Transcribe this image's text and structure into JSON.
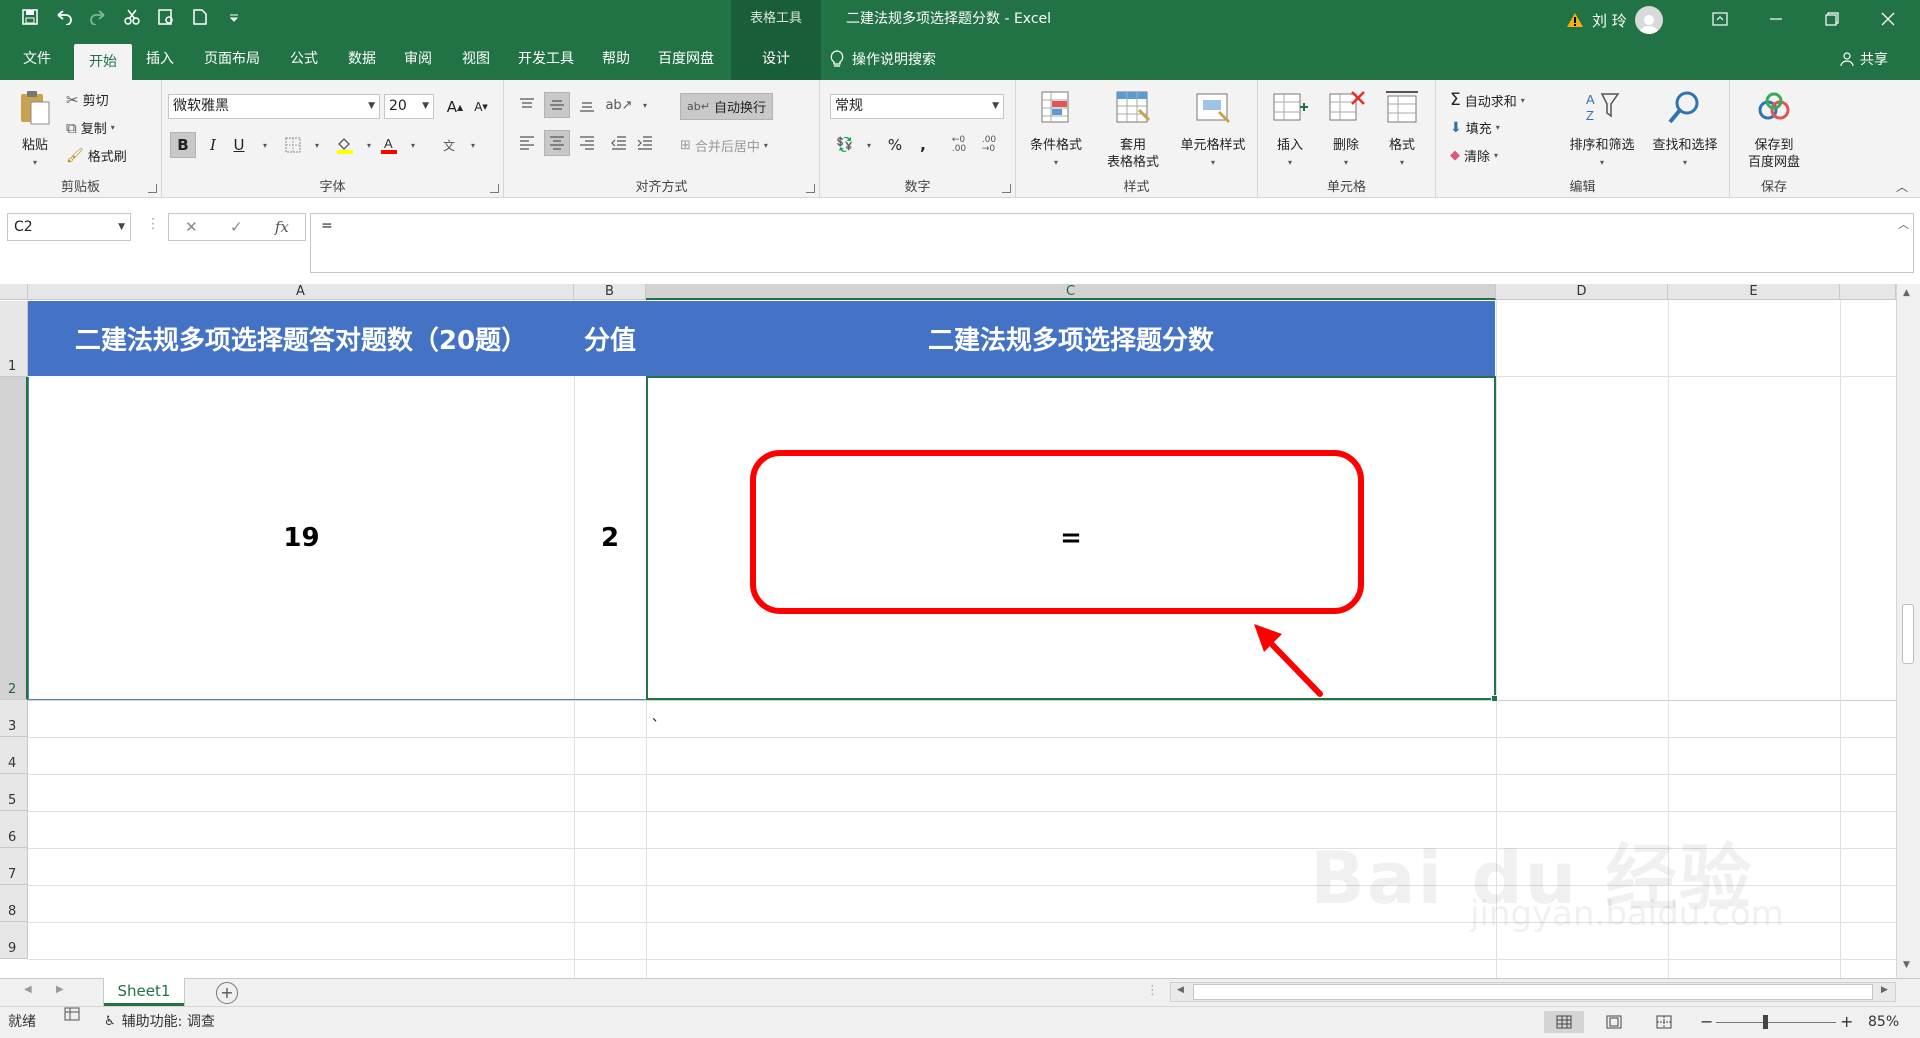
{
  "window": {
    "context_tab": "表格工具",
    "title": "二建法规多项选择题分数 - Excel",
    "user_name": "刘 玲"
  },
  "tabs": {
    "file": "文件",
    "home": "开始",
    "insert": "插入",
    "page_layout": "页面布局",
    "formulas": "公式",
    "data": "数据",
    "review": "审阅",
    "view": "视图",
    "developer": "开发工具",
    "help": "帮助",
    "baidu_disk": "百度网盘",
    "design": "设计",
    "search": "操作说明搜索",
    "share": "共享"
  },
  "ribbon": {
    "clipboard": {
      "paste": "粘贴",
      "cut": "剪切",
      "copy": "复制",
      "format_painter": "格式刷",
      "label": "剪贴板"
    },
    "font": {
      "name": "微软雅黑",
      "size": "20",
      "label": "字体",
      "bold": "B",
      "italic": "I",
      "underline": "U"
    },
    "alignment": {
      "wrap_text": "自动换行",
      "merge_center": "合并后居中",
      "label": "对齐方式"
    },
    "number": {
      "format": "常规",
      "percent": "%",
      "comma": ",",
      "label": "数字"
    },
    "styles": {
      "conditional": "条件格式",
      "table_format_1": "套用",
      "table_format_2": "表格格式",
      "cell_styles": "单元格样式",
      "label": "样式"
    },
    "cells": {
      "insert": "插入",
      "delete": "删除",
      "format": "格式",
      "label": "单元格"
    },
    "editing": {
      "autosum": "自动求和",
      "fill": "填充",
      "clear": "清除",
      "sort_filter": "排序和筛选",
      "find_select": "查找和选择",
      "label": "编辑"
    },
    "save": {
      "save_1": "保存到",
      "save_2": "百度网盘",
      "label": "保存"
    }
  },
  "formula_bar": {
    "name_box": "C2",
    "fx": "fx",
    "content": "="
  },
  "grid": {
    "columns": [
      "A",
      "B",
      "C",
      "D",
      "E"
    ],
    "rows": [
      "1",
      "2",
      "3",
      "4",
      "5",
      "6",
      "7",
      "8",
      "9"
    ],
    "header_cells": [
      "二建法规多项选择题答对题数（20题）",
      "分值",
      "二建法规多项选择题分数"
    ],
    "data_cells": [
      "19",
      "2",
      "="
    ],
    "stray_mark": "、"
  },
  "colors": {
    "excel_green": "#217346",
    "header_blue": "#4472c4",
    "annotation_red": "#ff0000"
  },
  "sheets": {
    "active": "Sheet1"
  },
  "status": {
    "ready": "就绪",
    "accessibility": "辅助功能: 调查",
    "zoom": "85%"
  },
  "watermark": {
    "brand": "Bai du 经验",
    "url": "jingyan.baidu.com"
  }
}
